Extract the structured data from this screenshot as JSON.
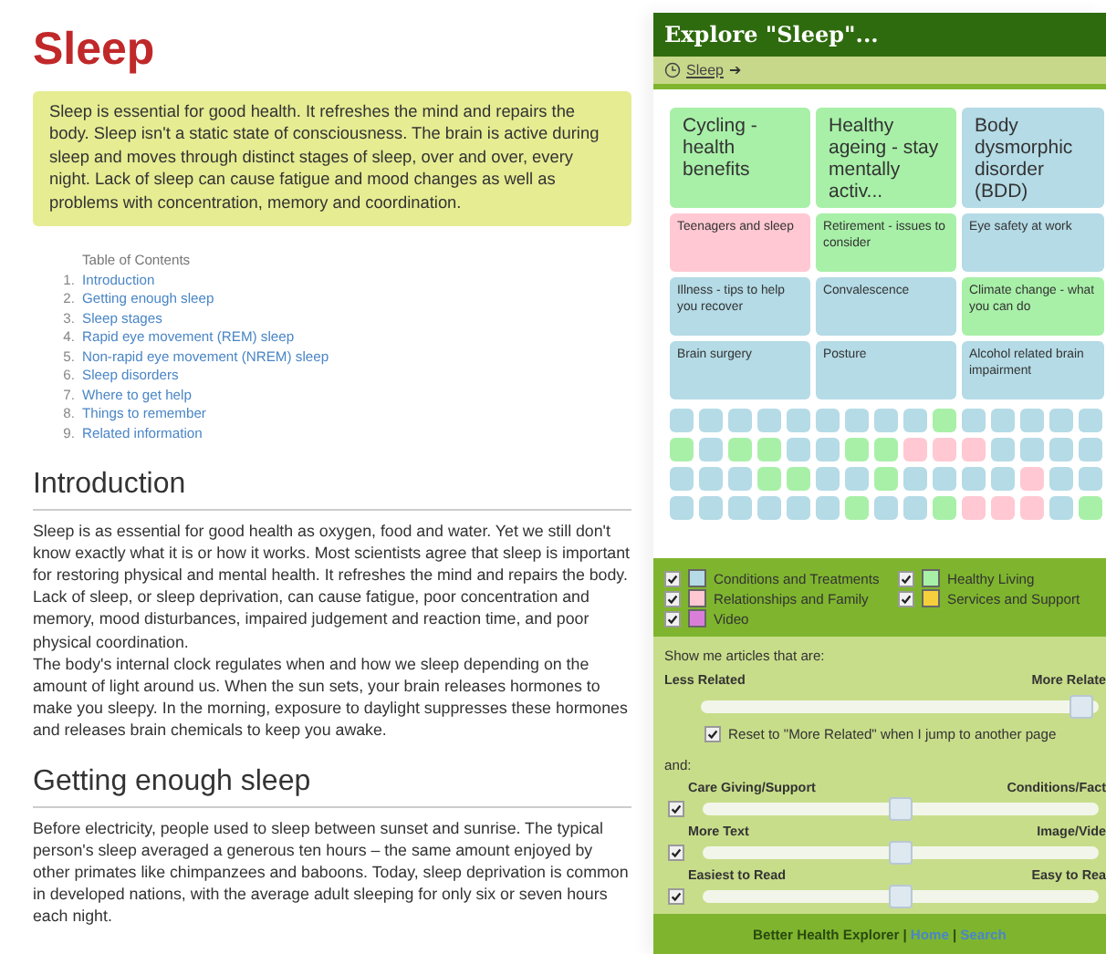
{
  "article": {
    "title": "Sleep",
    "summary": "Sleep is essential for good health. It refreshes the mind and repairs the body. Sleep isn't a static state of consciousness. The brain is active during sleep and moves through distinct stages of sleep, over and over, every night. Lack of sleep can cause fatigue and mood changes as well as problems with concentration, memory and coordination.",
    "toc": {
      "heading": "Table of Contents",
      "items": [
        {
          "number": "1.",
          "text": "Introduction"
        },
        {
          "number": "2.",
          "text": "Getting enough sleep"
        },
        {
          "number": "3.",
          "text": "Sleep stages"
        },
        {
          "number": "4.",
          "text": "Rapid eye movement (REM) sleep"
        },
        {
          "number": "5.",
          "text": "Non-rapid eye movement (NREM) sleep"
        },
        {
          "number": "6.",
          "text": "Sleep disorders"
        },
        {
          "number": "7.",
          "text": "Where to get help"
        },
        {
          "number": "8.",
          "text": "Things to remember"
        },
        {
          "number": "9.",
          "text": "Related information"
        }
      ]
    },
    "sections": [
      {
        "heading": "Introduction",
        "paragraphs": [
          "Sleep is as essential for good health as oxygen, food and water. Yet we still don't know exactly what it is or how it works. Most scientists agree that sleep is important for restoring physical and mental health. It refreshes the mind and repairs the body. Lack of sleep, or sleep deprivation, can cause fatigue, poor concentration and memory, mood disturbances, impaired judgement and reaction time, and poor physical coordination.",
          "The body's internal clock regulates when and how we sleep depending on the amount of light around us. When the sun sets, your brain releases hormones to make you sleepy. In the morning, exposure to daylight suppresses these hormones and releases brain chemicals to keep you awake."
        ]
      },
      {
        "heading": "Getting enough sleep",
        "paragraphs": [
          "Before electricity, people used to sleep between sunset and sunrise. The typical person's sleep averaged a generous ten hours – the same amount enjoyed by other primates like chimpanzees and baboons. Today, sleep deprivation is common in developed nations, with the average adult sleeping for only six or seven hours each night."
        ]
      }
    ]
  },
  "explorer": {
    "title": "Explore \"Sleep\"...",
    "breadcrumb": {
      "link": "Sleep",
      "arrow": "➔"
    },
    "featured": [
      {
        "title": "Cycling - health benefits",
        "color": "#a8f0a8",
        "kind": "large"
      },
      {
        "title": "Healthy ageing - stay mentally activ...",
        "color": "#a8f0a8",
        "kind": "large"
      },
      {
        "title": "Body dysmorphic disorder (BDD)",
        "color": "#b4dbe6",
        "kind": "large"
      },
      {
        "title": "Teenagers and sleep",
        "color": "#ffc8d2",
        "kind": "small"
      },
      {
        "title": "Retirement - issues to consider",
        "color": "#a8f0a8",
        "kind": "small"
      },
      {
        "title": "Eye safety at work",
        "color": "#b4dbe6",
        "kind": "small"
      },
      {
        "title": "Illness - tips to help you recover",
        "color": "#b4dbe6",
        "kind": "small"
      },
      {
        "title": "Convalescence",
        "color": "#b4dbe6",
        "kind": "small"
      },
      {
        "title": "Climate change - what you can do",
        "color": "#a8f0a8",
        "kind": "small"
      },
      {
        "title": "Brain surgery",
        "color": "#b4dbe6",
        "kind": "small"
      },
      {
        "title": "Posture",
        "color": "#b4dbe6",
        "kind": "small"
      },
      {
        "title": "Alcohol related brain impairment",
        "color": "#b4dbe6",
        "kind": "small"
      }
    ],
    "tiles": [
      {
        "color": "#b4dbe6"
      },
      {
        "color": "#b4dbe6"
      },
      {
        "color": "#b4dbe6"
      },
      {
        "color": "#b4dbe6"
      },
      {
        "color": "#b4dbe6"
      },
      {
        "color": "#b4dbe6"
      },
      {
        "color": "#b4dbe6"
      },
      {
        "color": "#b4dbe6"
      },
      {
        "color": "#b4dbe6"
      },
      {
        "color": "#a8f0a8"
      },
      {
        "color": "#b4dbe6"
      },
      {
        "color": "#b4dbe6"
      },
      {
        "color": "#b4dbe6"
      },
      {
        "color": "#b4dbe6"
      },
      {
        "color": "#b4dbe6"
      },
      {
        "color": "#a8f0a8"
      },
      {
        "color": "#b4dbe6"
      },
      {
        "color": "#a8f0a8"
      },
      {
        "color": "#a8f0a8"
      },
      {
        "color": "#b4dbe6"
      },
      {
        "color": "#b4dbe6"
      },
      {
        "color": "#a8f0a8"
      },
      {
        "color": "#a8f0a8"
      },
      {
        "color": "#ffc8d2"
      },
      {
        "color": "#ffc8d2"
      },
      {
        "color": "#ffc8d2"
      },
      {
        "color": "#b4dbe6"
      },
      {
        "color": "#b4dbe6"
      },
      {
        "color": "#b4dbe6"
      },
      {
        "color": "#b4dbe6"
      },
      {
        "color": "#b4dbe6"
      },
      {
        "color": "#b4dbe6"
      },
      {
        "color": "#b4dbe6"
      },
      {
        "color": "#a8f0a8"
      },
      {
        "color": "#a8f0a8"
      },
      {
        "color": "#b4dbe6"
      },
      {
        "color": "#b4dbe6"
      },
      {
        "color": "#a8f0a8"
      },
      {
        "color": "#b4dbe6"
      },
      {
        "color": "#b4dbe6"
      },
      {
        "color": "#b4dbe6"
      },
      {
        "color": "#b4dbe6"
      },
      {
        "color": "#ffc8d2"
      },
      {
        "color": "#b4dbe6"
      },
      {
        "color": "#b4dbe6"
      },
      {
        "color": "#b4dbe6"
      },
      {
        "color": "#b4dbe6"
      },
      {
        "color": "#b4dbe6"
      },
      {
        "color": "#b4dbe6"
      },
      {
        "color": "#b4dbe6"
      },
      {
        "color": "#b4dbe6"
      },
      {
        "color": "#a8f0a8"
      },
      {
        "color": "#b4dbe6"
      },
      {
        "color": "#b4dbe6"
      },
      {
        "color": "#a8f0a8"
      },
      {
        "color": "#ffc8d2"
      },
      {
        "color": "#ffc8d2"
      },
      {
        "color": "#ffc8d2"
      },
      {
        "color": "#b4dbe6"
      },
      {
        "color": "#a8f0a8"
      }
    ],
    "legend": [
      {
        "label": "Conditions and Treatments",
        "color": "#b4dbe6",
        "checked": true
      },
      {
        "label": "Healthy Living",
        "color": "#a8f0a8",
        "checked": true
      },
      {
        "label": "Relationships and Family",
        "color": "#ffc8d2",
        "checked": true
      },
      {
        "label": "Services and Support",
        "color": "#f5d03c",
        "checked": true
      },
      {
        "label": "Video",
        "color": "#d97fd9",
        "checked": true
      }
    ],
    "filters": {
      "prompt": "Show me articles that are:",
      "relatedness": {
        "left": "Less Related",
        "right": "More Relate",
        "level": 1
      },
      "reset": {
        "label": "Reset to \"More Related\" when I jump to another page",
        "checked": true
      },
      "and_label": "and:",
      "sliders": [
        {
          "left": "Care Giving/Support",
          "right": "Conditions/Fact",
          "level": 0.5,
          "checked": true
        },
        {
          "left": "More Text",
          "right": "Image/Vide",
          "level": 0.5,
          "checked": true
        },
        {
          "left": "Easiest to Read",
          "right": "Easy to Rea",
          "level": 0.5,
          "checked": true
        }
      ]
    },
    "footer": [
      {
        "kind": "label",
        "text": "Better Health Explorer"
      },
      {
        "kind": "separator",
        "text": "|"
      },
      {
        "kind": "link",
        "text": "Home"
      },
      {
        "kind": "separator",
        "text": "|"
      },
      {
        "kind": "link",
        "text": "Search"
      }
    ]
  }
}
